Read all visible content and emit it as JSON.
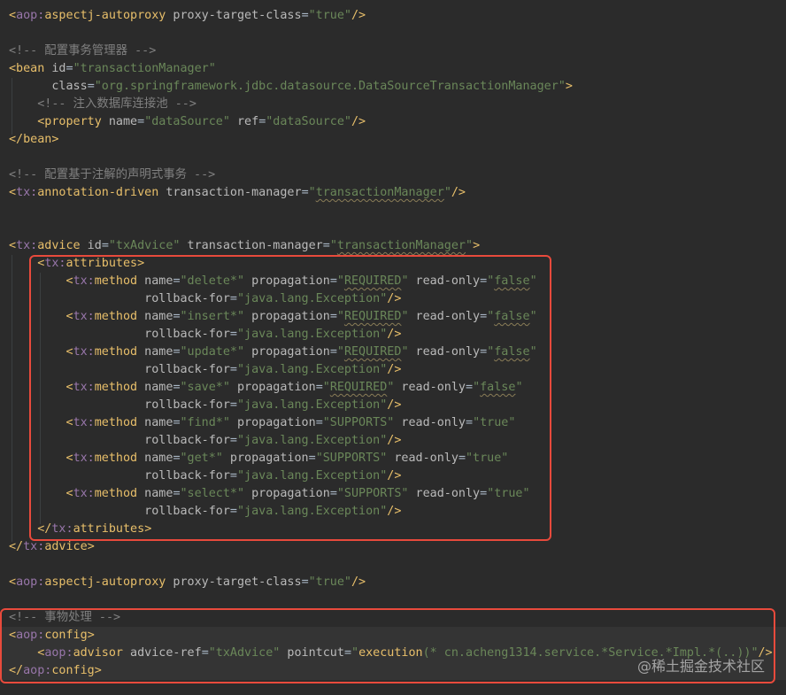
{
  "colors": {
    "background": "#2b2b2b",
    "tag": "#e8bf6a",
    "namespace": "#9876aa",
    "attribute": "#bababa",
    "string": "#6a8759",
    "comment": "#808080",
    "plain": "#a9b7c6",
    "highlight_box": "#e84a3c"
  },
  "watermark": "@稀土掘金技术社区",
  "lines": [
    [
      [
        "<",
        "tk-bracket"
      ],
      [
        "aop:",
        "tk-ns"
      ],
      [
        "aspectj-autoproxy",
        "tk-tag"
      ],
      [
        " proxy-target-class",
        "tk-attr"
      ],
      [
        "=",
        "tk-plain"
      ],
      [
        "\"true\"",
        "tk-val"
      ],
      [
        "/>",
        "tk-bracket"
      ]
    ],
    [],
    [
      [
        "<!-- 配置事务管理器 -->",
        "tk-comment"
      ]
    ],
    [
      [
        "<bean",
        "tk-tag"
      ],
      [
        " id",
        "tk-attr"
      ],
      [
        "=",
        "tk-plain"
      ],
      [
        "\"transactionManager\"",
        "tk-val"
      ]
    ],
    [
      [
        "      class",
        "tk-attr"
      ],
      [
        "=",
        "tk-plain"
      ],
      [
        "\"org.springframework.jdbc.datasource.DataSourceTransactionManager\"",
        "tk-val"
      ],
      [
        ">",
        "tk-tag"
      ]
    ],
    [
      [
        "    <!-- 注入数据库连接池 -->",
        "tk-comment"
      ]
    ],
    [
      [
        "    <property",
        "tk-tag"
      ],
      [
        " name",
        "tk-attr"
      ],
      [
        "=",
        "tk-plain"
      ],
      [
        "\"dataSource\"",
        "tk-val"
      ],
      [
        " ref",
        "tk-attr"
      ],
      [
        "=",
        "tk-plain"
      ],
      [
        "\"dataSource\"",
        "tk-val"
      ],
      [
        "/>",
        "tk-tag"
      ]
    ],
    [
      [
        "</bean>",
        "tk-tag"
      ]
    ],
    [],
    [
      [
        "<!-- 配置基于注解的声明式事务 -->",
        "tk-comment"
      ]
    ],
    [
      [
        "<",
        "tk-bracket"
      ],
      [
        "tx:",
        "tk-ns"
      ],
      [
        "annotation-driven",
        "tk-tag"
      ],
      [
        " transaction-manager",
        "tk-attr"
      ],
      [
        "=",
        "tk-plain"
      ],
      [
        "\"",
        "tk-val"
      ],
      [
        "transactionManager",
        "tk-val tk-squiggle"
      ],
      [
        "\"",
        "tk-val"
      ],
      [
        "/>",
        "tk-tag"
      ]
    ],
    [],
    [],
    [
      [
        "<",
        "tk-bracket"
      ],
      [
        "tx:",
        "tk-ns"
      ],
      [
        "advice",
        "tk-tag"
      ],
      [
        " id",
        "tk-attr"
      ],
      [
        "=",
        "tk-plain"
      ],
      [
        "\"txAdvice\"",
        "tk-val"
      ],
      [
        " transaction-manager",
        "tk-attr"
      ],
      [
        "=",
        "tk-plain"
      ],
      [
        "\"",
        "tk-val"
      ],
      [
        "transactionManager",
        "tk-val tk-squiggle"
      ],
      [
        "\"",
        "tk-val"
      ],
      [
        ">",
        "tk-tag"
      ]
    ],
    [
      [
        "    <",
        "tk-bracket"
      ],
      [
        "tx:",
        "tk-ns"
      ],
      [
        "attributes",
        "tk-tag"
      ],
      [
        ">",
        "tk-tag"
      ]
    ],
    [
      [
        "        <",
        "tk-bracket"
      ],
      [
        "tx:",
        "tk-ns"
      ],
      [
        "method",
        "tk-tag"
      ],
      [
        " name",
        "tk-attr"
      ],
      [
        "=",
        "tk-plain"
      ],
      [
        "\"delete*\"",
        "tk-val"
      ],
      [
        " propagation",
        "tk-attr"
      ],
      [
        "=",
        "tk-plain"
      ],
      [
        "\"",
        "tk-val"
      ],
      [
        "REQUIRED",
        "tk-val tk-squiggle"
      ],
      [
        "\"",
        "tk-val"
      ],
      [
        " read-only",
        "tk-attr"
      ],
      [
        "=",
        "tk-plain"
      ],
      [
        "\"",
        "tk-val"
      ],
      [
        "false",
        "tk-val tk-squiggle"
      ],
      [
        "\"",
        "tk-val"
      ]
    ],
    [
      [
        "                   rollback-for",
        "tk-attr"
      ],
      [
        "=",
        "tk-plain"
      ],
      [
        "\"java.lang.Exception\"",
        "tk-val"
      ],
      [
        "/>",
        "tk-tag"
      ]
    ],
    [
      [
        "        <",
        "tk-bracket"
      ],
      [
        "tx:",
        "tk-ns"
      ],
      [
        "method",
        "tk-tag"
      ],
      [
        " name",
        "tk-attr"
      ],
      [
        "=",
        "tk-plain"
      ],
      [
        "\"insert*\"",
        "tk-val"
      ],
      [
        " propagation",
        "tk-attr"
      ],
      [
        "=",
        "tk-plain"
      ],
      [
        "\"",
        "tk-val"
      ],
      [
        "REQUIRED",
        "tk-val tk-squiggle"
      ],
      [
        "\"",
        "tk-val"
      ],
      [
        " read-only",
        "tk-attr"
      ],
      [
        "=",
        "tk-plain"
      ],
      [
        "\"",
        "tk-val"
      ],
      [
        "false",
        "tk-val tk-squiggle"
      ],
      [
        "\"",
        "tk-val"
      ]
    ],
    [
      [
        "                   rollback-for",
        "tk-attr"
      ],
      [
        "=",
        "tk-plain"
      ],
      [
        "\"java.lang.Exception\"",
        "tk-val"
      ],
      [
        "/>",
        "tk-tag"
      ]
    ],
    [
      [
        "        <",
        "tk-bracket"
      ],
      [
        "tx:",
        "tk-ns"
      ],
      [
        "method",
        "tk-tag"
      ],
      [
        " name",
        "tk-attr"
      ],
      [
        "=",
        "tk-plain"
      ],
      [
        "\"update*\"",
        "tk-val"
      ],
      [
        " propagation",
        "tk-attr"
      ],
      [
        "=",
        "tk-plain"
      ],
      [
        "\"",
        "tk-val"
      ],
      [
        "REQUIRED",
        "tk-val tk-squiggle"
      ],
      [
        "\"",
        "tk-val"
      ],
      [
        " read-only",
        "tk-attr"
      ],
      [
        "=",
        "tk-plain"
      ],
      [
        "\"",
        "tk-val"
      ],
      [
        "false",
        "tk-val tk-squiggle"
      ],
      [
        "\"",
        "tk-val"
      ]
    ],
    [
      [
        "                   rollback-for",
        "tk-attr"
      ],
      [
        "=",
        "tk-plain"
      ],
      [
        "\"java.lang.Exception\"",
        "tk-val"
      ],
      [
        "/>",
        "tk-tag"
      ]
    ],
    [
      [
        "        <",
        "tk-bracket"
      ],
      [
        "tx:",
        "tk-ns"
      ],
      [
        "method",
        "tk-tag"
      ],
      [
        " name",
        "tk-attr"
      ],
      [
        "=",
        "tk-plain"
      ],
      [
        "\"save*\"",
        "tk-val"
      ],
      [
        " propagation",
        "tk-attr"
      ],
      [
        "=",
        "tk-plain"
      ],
      [
        "\"",
        "tk-val"
      ],
      [
        "REQUIRED",
        "tk-val tk-squiggle"
      ],
      [
        "\"",
        "tk-val"
      ],
      [
        " read-only",
        "tk-attr"
      ],
      [
        "=",
        "tk-plain"
      ],
      [
        "\"",
        "tk-val"
      ],
      [
        "false",
        "tk-val tk-squiggle"
      ],
      [
        "\"",
        "tk-val"
      ]
    ],
    [
      [
        "                   rollback-for",
        "tk-attr"
      ],
      [
        "=",
        "tk-plain"
      ],
      [
        "\"java.lang.Exception\"",
        "tk-val"
      ],
      [
        "/>",
        "tk-tag"
      ]
    ],
    [
      [
        "        <",
        "tk-bracket"
      ],
      [
        "tx:",
        "tk-ns"
      ],
      [
        "method",
        "tk-tag"
      ],
      [
        " name",
        "tk-attr"
      ],
      [
        "=",
        "tk-plain"
      ],
      [
        "\"find*\"",
        "tk-val"
      ],
      [
        " propagation",
        "tk-attr"
      ],
      [
        "=",
        "tk-plain"
      ],
      [
        "\"SUPPORTS\"",
        "tk-val"
      ],
      [
        " read-only",
        "tk-attr"
      ],
      [
        "=",
        "tk-plain"
      ],
      [
        "\"true\"",
        "tk-val"
      ]
    ],
    [
      [
        "                   rollback-for",
        "tk-attr"
      ],
      [
        "=",
        "tk-plain"
      ],
      [
        "\"java.lang.Exception\"",
        "tk-val"
      ],
      [
        "/>",
        "tk-tag"
      ]
    ],
    [
      [
        "        <",
        "tk-bracket"
      ],
      [
        "tx:",
        "tk-ns"
      ],
      [
        "method",
        "tk-tag"
      ],
      [
        " name",
        "tk-attr"
      ],
      [
        "=",
        "tk-plain"
      ],
      [
        "\"get*\"",
        "tk-val"
      ],
      [
        " propagation",
        "tk-attr"
      ],
      [
        "=",
        "tk-plain"
      ],
      [
        "\"SUPPORTS\"",
        "tk-val"
      ],
      [
        " read-only",
        "tk-attr"
      ],
      [
        "=",
        "tk-plain"
      ],
      [
        "\"true\"",
        "tk-val"
      ]
    ],
    [
      [
        "                   rollback-for",
        "tk-attr"
      ],
      [
        "=",
        "tk-plain"
      ],
      [
        "\"java.lang.Exception\"",
        "tk-val"
      ],
      [
        "/>",
        "tk-tag"
      ]
    ],
    [
      [
        "        <",
        "tk-bracket"
      ],
      [
        "tx:",
        "tk-ns"
      ],
      [
        "method",
        "tk-tag"
      ],
      [
        " name",
        "tk-attr"
      ],
      [
        "=",
        "tk-plain"
      ],
      [
        "\"select*\"",
        "tk-val"
      ],
      [
        " propagation",
        "tk-attr"
      ],
      [
        "=",
        "tk-plain"
      ],
      [
        "\"SUPPORTS\"",
        "tk-val"
      ],
      [
        " read-only",
        "tk-attr"
      ],
      [
        "=",
        "tk-plain"
      ],
      [
        "\"true\"",
        "tk-val"
      ]
    ],
    [
      [
        "                   rollback-for",
        "tk-attr"
      ],
      [
        "=",
        "tk-plain"
      ],
      [
        "\"java.lang.Exception\"",
        "tk-val"
      ],
      [
        "/>",
        "tk-tag"
      ]
    ],
    [
      [
        "    </",
        "tk-bracket"
      ],
      [
        "tx:",
        "tk-ns"
      ],
      [
        "attributes",
        "tk-tag"
      ],
      [
        ">",
        "tk-tag"
      ]
    ],
    [
      [
        "</",
        "tk-bracket"
      ],
      [
        "tx:",
        "tk-ns"
      ],
      [
        "advice",
        "tk-tag"
      ],
      [
        ">",
        "tk-tag"
      ]
    ],
    [],
    [
      [
        "<",
        "tk-bracket"
      ],
      [
        "aop:",
        "tk-ns"
      ],
      [
        "aspectj-autoproxy",
        "tk-tag"
      ],
      [
        " proxy-target-class",
        "tk-attr"
      ],
      [
        "=",
        "tk-plain"
      ],
      [
        "\"true\"",
        "tk-val"
      ],
      [
        "/>",
        "tk-bracket"
      ]
    ],
    [],
    [
      [
        "<!-- 事物处理 -->",
        "tk-comment"
      ]
    ],
    [
      [
        "<",
        "tk-bracket"
      ],
      [
        "aop:",
        "tk-ns"
      ],
      [
        "config",
        "tk-tag"
      ],
      [
        ">",
        "tk-tag"
      ]
    ],
    [
      [
        "    <",
        "tk-bracket"
      ],
      [
        "aop:",
        "tk-ns"
      ],
      [
        "advisor",
        "tk-tag"
      ],
      [
        " advice-ref",
        "tk-attr"
      ],
      [
        "=",
        "tk-plain"
      ],
      [
        "\"txAdvice\"",
        "tk-val"
      ],
      [
        " pointcut",
        "tk-attr"
      ],
      [
        "=",
        "tk-plain"
      ],
      [
        "\"",
        "tk-val"
      ],
      [
        "execution",
        "tk-tag"
      ],
      [
        "(* cn.acheng1314.service.*Service.*Impl.*(..))",
        "tk-val"
      ],
      [
        "\"",
        "tk-val"
      ],
      [
        "/>",
        "tk-tag"
      ]
    ],
    [
      [
        "</",
        "tk-bracket"
      ],
      [
        "aop:",
        "tk-ns"
      ],
      [
        "config",
        "tk-tag"
      ],
      [
        ">",
        "tk-tag"
      ]
    ]
  ]
}
